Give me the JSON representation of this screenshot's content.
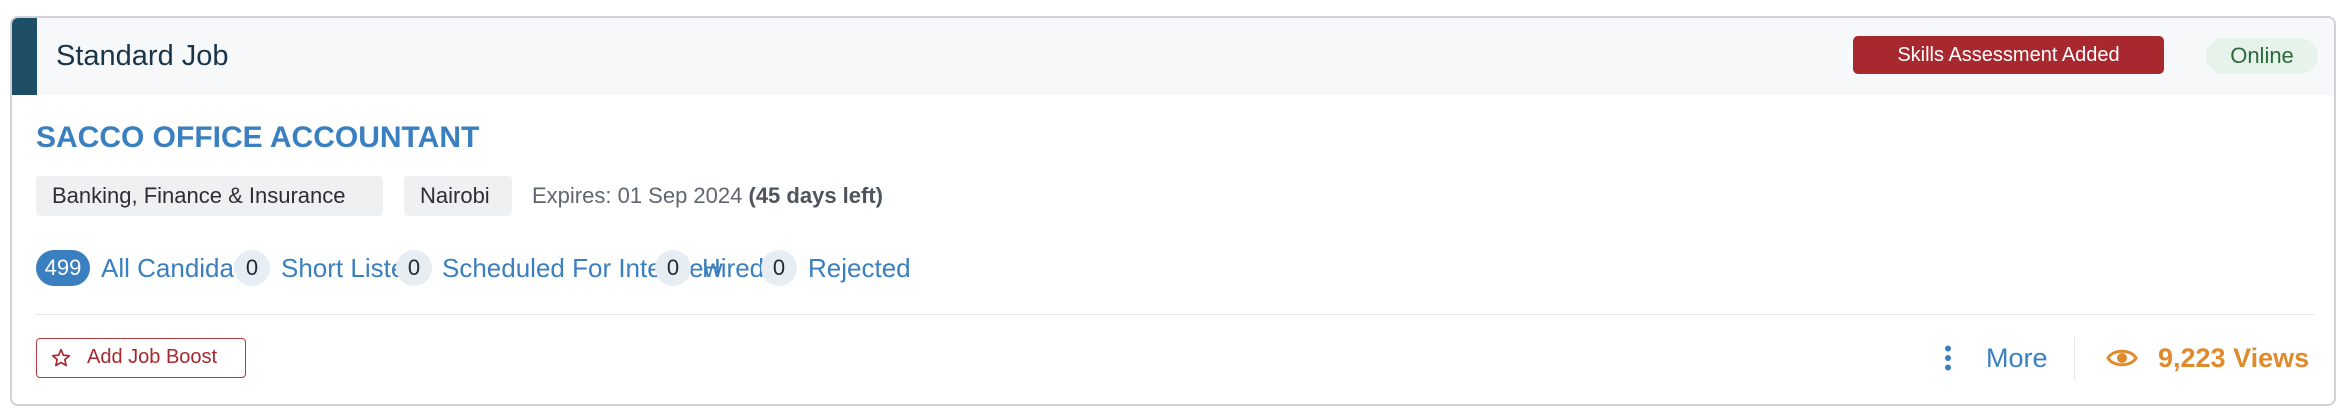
{
  "header": {
    "job_type": "Standard Job",
    "skills_badge": "Skills Assessment Added",
    "status": "Online"
  },
  "job": {
    "title": "SACCO OFFICE ACCOUNTANT",
    "industry": "Banking, Finance & Insurance",
    "location": "Nairobi",
    "expires_label": "Expires: 01 Sep 2024",
    "days_left": "(45 days left)"
  },
  "stats": [
    {
      "count": "499",
      "label": "All Candidates"
    },
    {
      "count": "0",
      "label": "Short Listed"
    },
    {
      "count": "0",
      "label": "Scheduled For Interview"
    },
    {
      "count": "0",
      "label": "Hired"
    },
    {
      "count": "0",
      "label": "Rejected"
    }
  ],
  "footer": {
    "boost_label": "Add Job Boost",
    "more_label": "More",
    "views_label": "9,223 Views"
  },
  "icons": {
    "boost": "star-icon",
    "more": "vertical-dots-icon",
    "views": "eye-icon"
  },
  "colors": {
    "accent_blue": "#3a7fc0",
    "header_bar": "#1e4e66",
    "badge_red": "#a8282f",
    "status_green": "#2a6a3b",
    "views_orange": "#e08a2e"
  }
}
